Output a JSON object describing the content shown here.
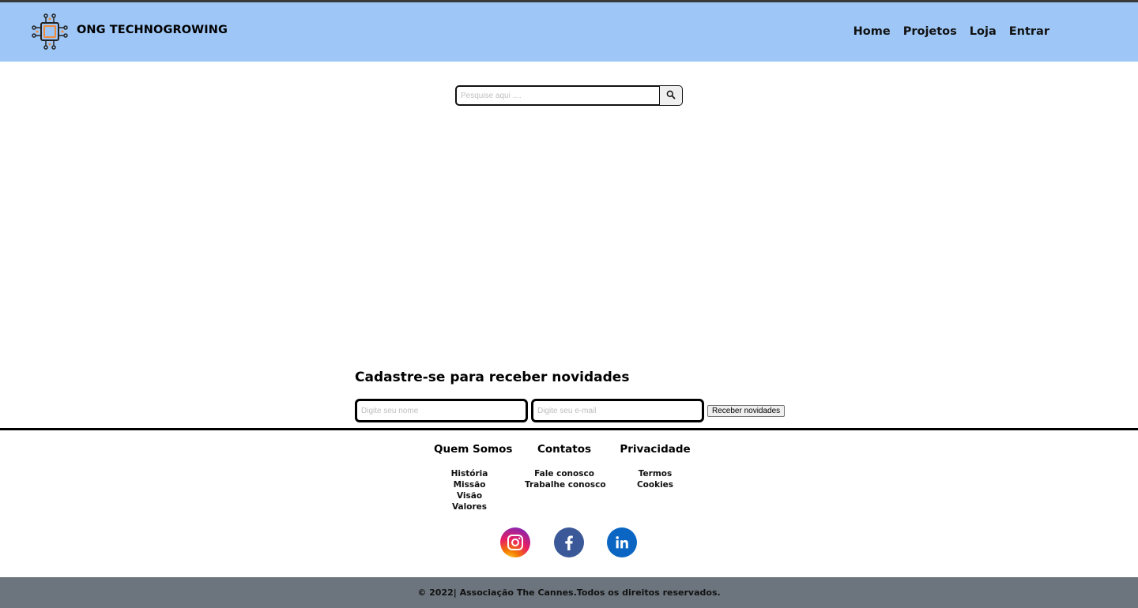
{
  "header": {
    "brand": "ONG TECHNOGROWING",
    "logo_icon": "circuit-chip-icon",
    "bg_color": "#9ec7f7",
    "nav": [
      {
        "label": "Home"
      },
      {
        "label": "Projetos"
      },
      {
        "label": "Loja"
      },
      {
        "label": "Entrar"
      }
    ]
  },
  "search": {
    "placeholder": "Pesquise aqui ....",
    "value": "",
    "button_icon": "search-icon"
  },
  "newsletter": {
    "title": "Cadastre-se para receber novidades",
    "name_placeholder": "Digite seu nome",
    "email_placeholder": "Digite seu e-mail",
    "submit_label": "Receber novidades"
  },
  "footer": {
    "columns": [
      {
        "title": "Quem Somos",
        "links": [
          "História",
          "Missão",
          "Visão",
          "Valores"
        ]
      },
      {
        "title": "Contatos",
        "links": [
          "Fale conosco",
          "Trabalhe conosco"
        ]
      },
      {
        "title": "Privacidade",
        "links": [
          "Termos",
          "Cookies"
        ]
      }
    ],
    "social": [
      {
        "icon": "instagram-icon"
      },
      {
        "icon": "facebook-icon",
        "color": "#3b5998"
      },
      {
        "icon": "linkedin-icon",
        "color": "#0a66c2"
      }
    ],
    "copyright": "© 2022| Associação The Cannes.Todos os direitos reservados.",
    "copyright_bg": "#6c757d"
  }
}
